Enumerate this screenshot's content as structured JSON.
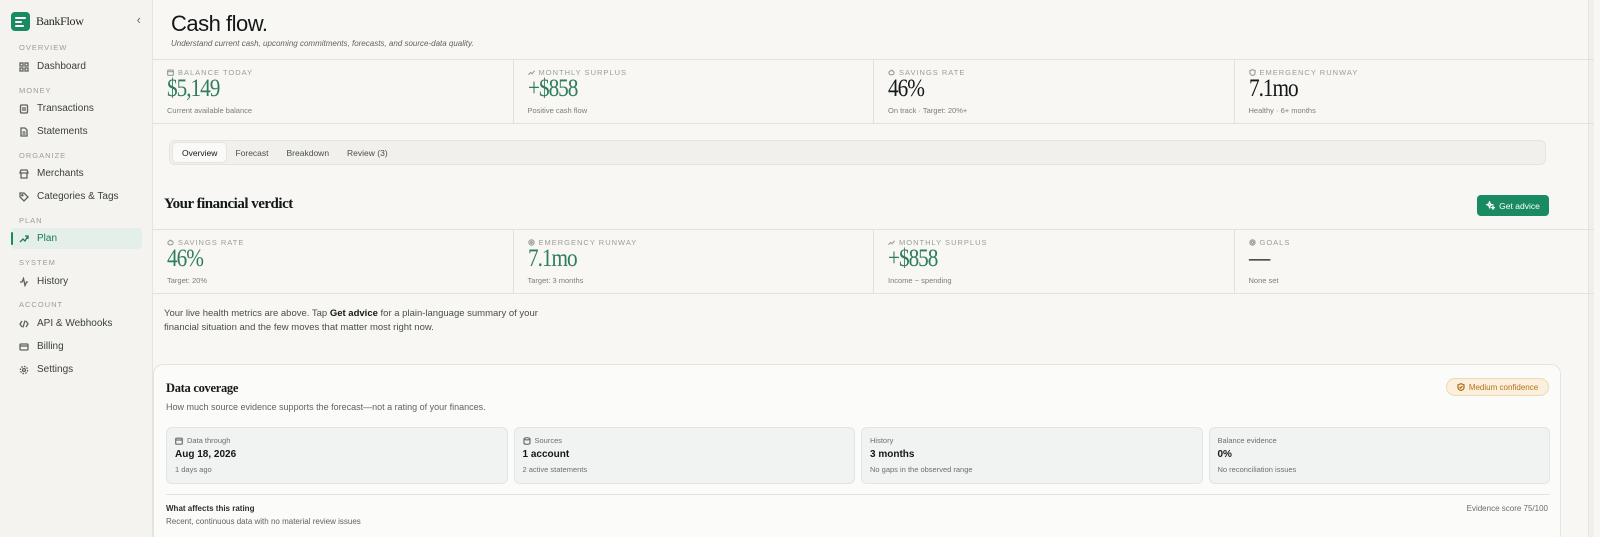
{
  "sidebar": {
    "brand": "BankFlow",
    "sections": {
      "overview": "OVERVIEW",
      "money": "MONEY",
      "organize": "ORGANIZE",
      "plan": "PLAN",
      "system": "SYSTEM",
      "account": "ACCOUNT"
    },
    "items": {
      "dashboard": "Dashboard",
      "transactions": "Transactions",
      "statements": "Statements",
      "merchants": "Merchants",
      "categories": "Categories & Tags",
      "plan": "Plan",
      "history": "History",
      "api": "API & Webhooks",
      "billing": "Billing",
      "settings": "Settings"
    },
    "active": "plan"
  },
  "header": {
    "title": "Cash flow.",
    "subtitle": "Understand current cash, upcoming commitments, forecasts, and source-data quality."
  },
  "stats": [
    {
      "label": "BALANCE TODAY",
      "value": "$5,149",
      "sub": "Current available balance",
      "icon": "calendar-icon",
      "color": "#2e7d5b"
    },
    {
      "label": "MONTHLY SURPLUS",
      "value": "+$858",
      "sub": "Positive cash flow",
      "icon": "trend-up-icon",
      "color": "#2e7d5b"
    },
    {
      "label": "SAVINGS RATE",
      "value": "46%",
      "sub": "On track · Target: 20%+",
      "icon": "piggy-bank-icon",
      "color": "#141816"
    },
    {
      "label": "EMERGENCY RUNWAY",
      "value": "7.1mo",
      "sub": "Healthy · 6+ months",
      "icon": "shield-icon",
      "color": "#141816"
    }
  ],
  "tabs": [
    "Overview",
    "Forecast",
    "Breakdown",
    "Review (3)"
  ],
  "verdict": {
    "title": "Your financial verdict",
    "advice_button": "Get advice",
    "metrics": [
      {
        "label": "SAVINGS RATE",
        "value": "46%",
        "sub": "Target: 20%",
        "icon": "piggy-bank-icon"
      },
      {
        "label": "EMERGENCY RUNWAY",
        "value": "7.1mo",
        "sub": "Target: 3 months",
        "icon": "shield-icon"
      },
      {
        "label": "MONTHLY SURPLUS",
        "value": "+$858",
        "sub": "Income − spending",
        "icon": "trend-up-icon"
      },
      {
        "label": "GOALS",
        "value": "—",
        "sub": "None set",
        "icon": "target-icon"
      }
    ],
    "text_before": "Your live health metrics are above. Tap ",
    "text_bold": "Get advice",
    "text_after": " for a plain-language summary of your financial situation and the few moves that matter most right now."
  },
  "coverage": {
    "title": "Data coverage",
    "subtitle": "How much source evidence supports the forecast—not a rating of your finances.",
    "badge": "Medium confidence",
    "cards": [
      {
        "label": "Data through",
        "value": "Aug 18, 2026",
        "sub": "1 days ago",
        "icon": "calendar-icon"
      },
      {
        "label": "Sources",
        "value": "1 account",
        "sub": "2 active statements",
        "icon": "database-icon"
      },
      {
        "label": "History",
        "value": "3 months",
        "sub": "No gaps in the observed range",
        "icon": ""
      },
      {
        "label": "Balance evidence",
        "value": "0%",
        "sub": "No reconciliation issues",
        "icon": ""
      }
    ],
    "affects_title": "What affects this rating",
    "affects_sub": "Recent, continuous data with no material review issues",
    "evidence_score": "Evidence score 75/100"
  },
  "colors": {
    "accent": "#1a8a63",
    "accent_text": "#2e7d5b",
    "warning": "#b4701a"
  }
}
